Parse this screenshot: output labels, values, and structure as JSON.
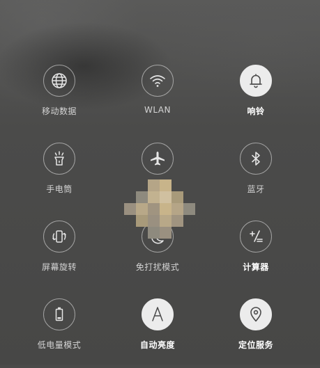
{
  "tiles": [
    {
      "label": "移动数据",
      "icon": "globe-icon",
      "on": false
    },
    {
      "label": "WLAN",
      "icon": "wifi-icon",
      "on": false
    },
    {
      "label": "响铃",
      "icon": "bell-icon",
      "on": true
    },
    {
      "label": "手电筒",
      "icon": "flashlight-icon",
      "on": false
    },
    {
      "label": "",
      "icon": "airplane-icon",
      "on": false
    },
    {
      "label": "蓝牙",
      "icon": "bluetooth-icon",
      "on": false
    },
    {
      "label": "屏幕旋转",
      "icon": "rotate-icon",
      "on": false
    },
    {
      "label": "免打扰模式",
      "icon": "moon-icon",
      "on": false
    },
    {
      "label": "计算器",
      "icon": "calculator-icon",
      "on": false
    },
    {
      "label": "低电量模式",
      "icon": "battery-icon",
      "on": false
    },
    {
      "label": "自动亮度",
      "icon": "auto-brightness-icon",
      "on": true
    },
    {
      "label": "定位服务",
      "icon": "location-icon",
      "on": true
    }
  ],
  "colors": {
    "active_circle": "#ececec",
    "active_icon": "#4a4a4a",
    "inactive_icon": "#e6e6e6",
    "label": "#d4d4d4",
    "active_label": "#ffffff",
    "mosaic": [
      "#c8b48a",
      "#a89a7a",
      "#d0c0a0",
      "#8e8a7e",
      "#b8a888",
      "#9a9080",
      "#c2b290",
      "#a09480"
    ]
  }
}
